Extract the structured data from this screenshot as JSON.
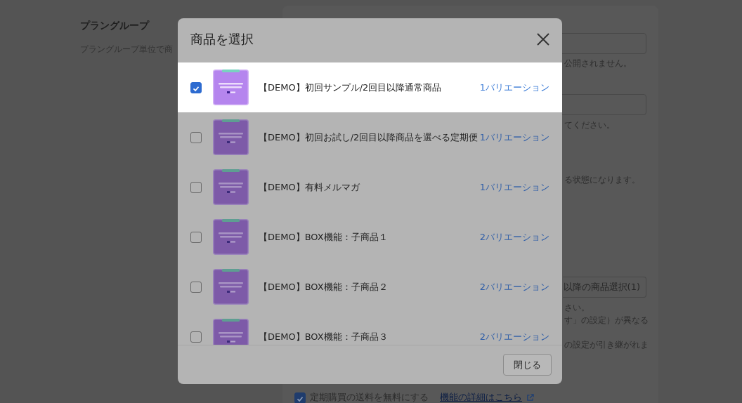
{
  "page": {
    "heading": "プラングループ",
    "description": "プラングループ単位で商",
    "panel": {
      "note_1": "公開されません。",
      "note_2": "てください。",
      "note_3": "る状態になります。",
      "select_button": "以降の商品選択(1)",
      "note_4": "さい。",
      "note_5": "す」の設定）が異なる",
      "note_6": "の設定が引き継がれま",
      "free_shipping": {
        "label": "定期購買の送料を無料にする",
        "checked": true,
        "link": "機能の詳細はこちら"
      }
    }
  },
  "modal": {
    "title": "商品を選択",
    "close_button": "閉じる",
    "items": [
      {
        "title": "【DEMO】初回サンプル/2回目以降通常商品",
        "variations": "1バリエーション",
        "selected": true
      },
      {
        "title": "【DEMO】初回お試し/2回目以降商品を選べる定期便",
        "variations": "1バリエーション",
        "selected": false
      },
      {
        "title": "【DEMO】有料メルマガ",
        "variations": "1バリエーション",
        "selected": false
      },
      {
        "title": "【DEMO】BOX機能：子商品１",
        "variations": "2バリエーション",
        "selected": false
      },
      {
        "title": "【DEMO】BOX機能：子商品２",
        "variations": "2バリエーション",
        "selected": false
      },
      {
        "title": "【DEMO】BOX機能：子商品３",
        "variations": "2バリエーション",
        "selected": false
      }
    ]
  }
}
